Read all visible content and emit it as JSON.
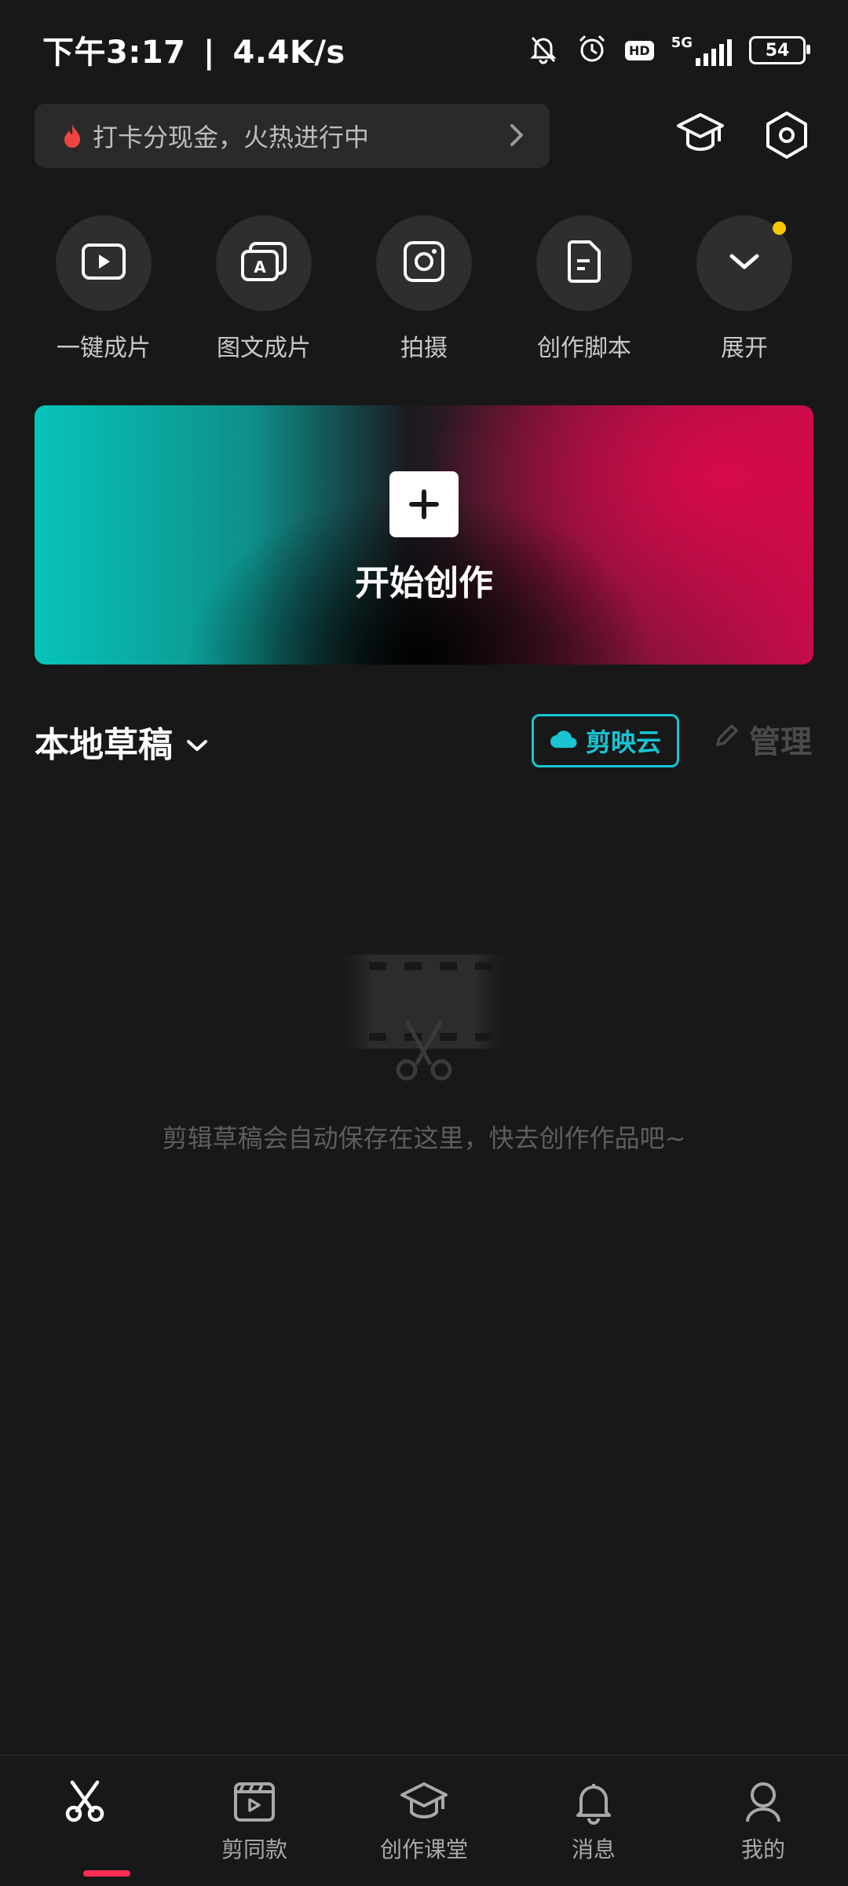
{
  "status_bar": {
    "time": "下午3:17",
    "speed": "4.4K/s",
    "network": "5G",
    "hd": "HD",
    "battery": "54",
    "icons": [
      "mute-bell-icon",
      "alarm-icon",
      "hd-icon",
      "signal-icon",
      "battery-icon"
    ]
  },
  "promo": {
    "text": "打卡分现金，火热进行中",
    "icon": "flame-icon"
  },
  "header_icons": [
    "graduation-cap-icon",
    "settings-hexagon-icon"
  ],
  "tools": [
    {
      "label": "一键成片",
      "icon": "play-video-icon"
    },
    {
      "label": "图文成片",
      "icon": "text-to-video-icon"
    },
    {
      "label": "拍摄",
      "icon": "camera-icon"
    },
    {
      "label": "创作脚本",
      "icon": "script-doc-icon"
    },
    {
      "label": "展开",
      "icon": "chevron-down-icon",
      "badge_color": "#f7c600"
    }
  ],
  "create_card": {
    "title": "开始创作"
  },
  "drafts": {
    "title": "本地草稿",
    "cloud_label": "剪映云",
    "manage_label": "管理",
    "empty_text": "剪辑草稿会自动保存在这里，快去创作作品吧~"
  },
  "bottom_nav": {
    "items": [
      {
        "label": "",
        "icon": "scissors-icon",
        "active": true
      },
      {
        "label": "剪同款",
        "icon": "template-clapper-icon"
      },
      {
        "label": "创作课堂",
        "icon": "graduation-cap-icon"
      },
      {
        "label": "消息",
        "icon": "bell-icon"
      },
      {
        "label": "我的",
        "icon": "profile-icon"
      }
    ]
  },
  "colors": {
    "accent_cyan": "#19c4d3",
    "active_tab": "#fe2c55",
    "background": "#181818"
  }
}
